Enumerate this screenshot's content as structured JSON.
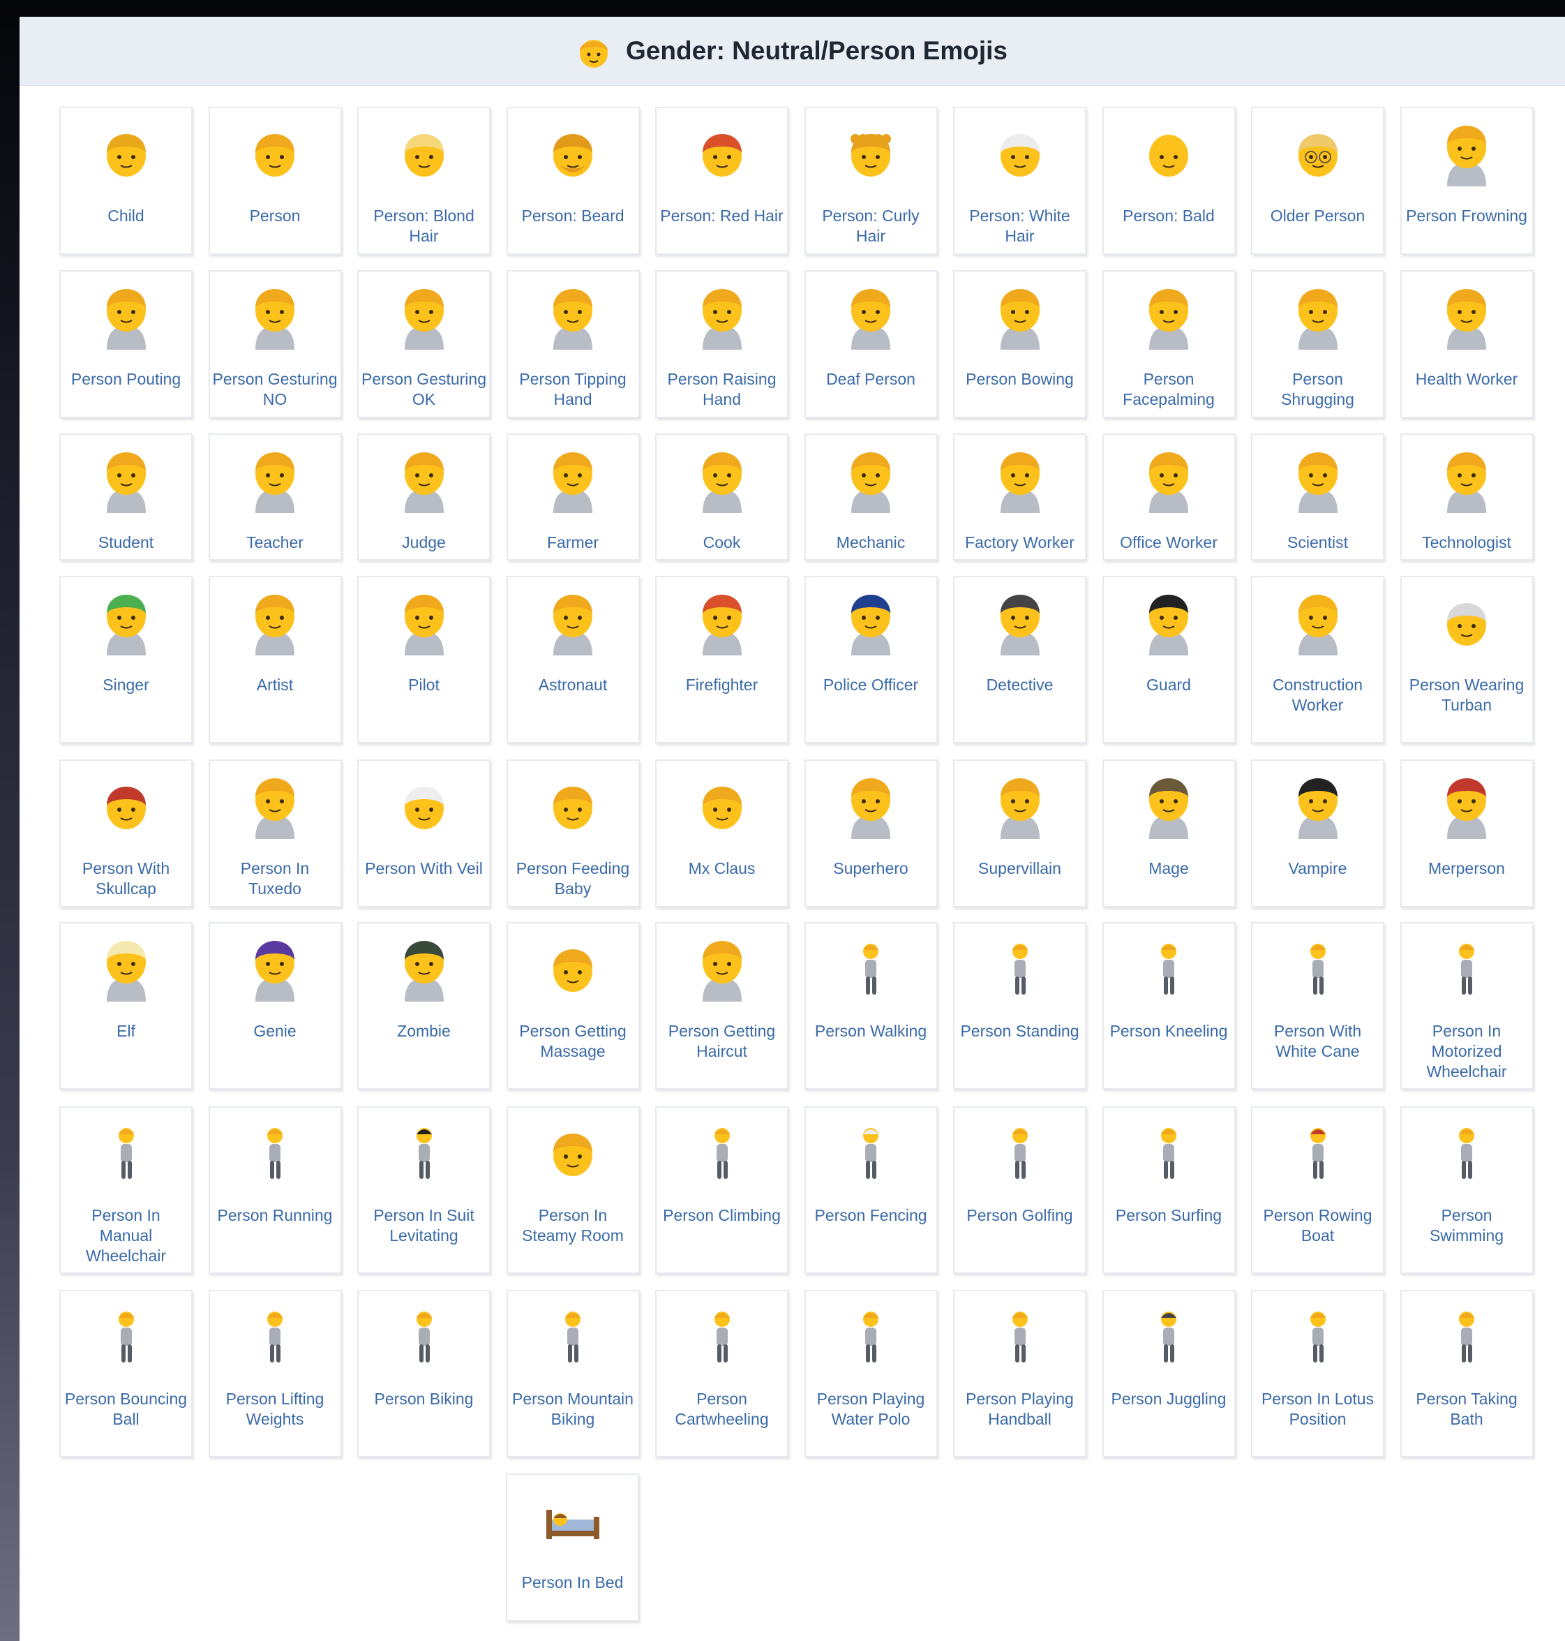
{
  "header": {
    "title": "Gender: Neutral/Person Emojis",
    "icon": "person-emoji-icon"
  },
  "colors": {
    "skin": "#fcc21b",
    "hair_blond": "#f5b31a",
    "link": "#3a6aa8",
    "header_bg": "#e9eef5"
  },
  "emojis": [
    {
      "label": "Child",
      "icon": "child-emoji-icon",
      "hair": "#e9a91a",
      "acc": ""
    },
    {
      "label": "Person",
      "icon": "person-emoji-icon",
      "hair": "#f0a91c",
      "acc": ""
    },
    {
      "label": "Person: Blond Hair",
      "icon": "person-blond-hair-emoji-icon",
      "hair": "#f6d77a",
      "acc": ""
    },
    {
      "label": "Person: Beard",
      "icon": "person-beard-emoji-icon",
      "hair": "#e29a1a",
      "acc": "beard"
    },
    {
      "label": "Person: Red Hair",
      "icon": "person-red-hair-emoji-icon",
      "hair": "#d9502a",
      "acc": ""
    },
    {
      "label": "Person: Curly Hair",
      "icon": "person-curly-hair-emoji-icon",
      "hair": "#e6a21a",
      "acc": "curly"
    },
    {
      "label": "Person: White Hair",
      "icon": "person-white-hair-emoji-icon",
      "hair": "#ececec",
      "acc": ""
    },
    {
      "label": "Person: Bald",
      "icon": "person-bald-emoji-icon",
      "hair": "",
      "acc": ""
    },
    {
      "label": "Older Person",
      "icon": "older-person-emoji-icon",
      "hair": "#f0c96a",
      "acc": "glasses"
    },
    {
      "label": "Person Frowning",
      "icon": "person-frowning-emoji-icon",
      "hair": "#f0a91c",
      "acc": "body"
    },
    {
      "label": "Person Pouting",
      "icon": "person-pouting-emoji-icon",
      "hair": "#f0a91c",
      "acc": "body"
    },
    {
      "label": "Person Gesturing NO",
      "icon": "person-gesturing-no-emoji-icon",
      "hair": "#f0a91c",
      "acc": "body"
    },
    {
      "label": "Person Gesturing OK",
      "icon": "person-gesturing-ok-emoji-icon",
      "hair": "#f0a91c",
      "acc": "body"
    },
    {
      "label": "Person Tipping Hand",
      "icon": "person-tipping-hand-emoji-icon",
      "hair": "#f0a91c",
      "acc": "body"
    },
    {
      "label": "Person Raising Hand",
      "icon": "person-raising-hand-emoji-icon",
      "hair": "#f0a91c",
      "acc": "body"
    },
    {
      "label": "Deaf Person",
      "icon": "deaf-person-emoji-icon",
      "hair": "#f0a91c",
      "acc": "body"
    },
    {
      "label": "Person Bowing",
      "icon": "person-bowing-emoji-icon",
      "hair": "#f0a91c",
      "acc": "body"
    },
    {
      "label": "Person Facepalming",
      "icon": "person-facepalming-emoji-icon",
      "hair": "#f0a91c",
      "acc": "body"
    },
    {
      "label": "Person Shrugging",
      "icon": "person-shrugging-emoji-icon",
      "hair": "#f0a91c",
      "acc": "body"
    },
    {
      "label": "Health Worker",
      "icon": "health-worker-emoji-icon",
      "hair": "#f0a91c",
      "acc": "body"
    },
    {
      "label": "Student",
      "icon": "student-emoji-icon",
      "hair": "#f0a91c",
      "acc": "body"
    },
    {
      "label": "Teacher",
      "icon": "teacher-emoji-icon",
      "hair": "#f0a91c",
      "acc": "body"
    },
    {
      "label": "Judge",
      "icon": "judge-emoji-icon",
      "hair": "#f0a91c",
      "acc": "body"
    },
    {
      "label": "Farmer",
      "icon": "farmer-emoji-icon",
      "hair": "#f0a91c",
      "acc": "body"
    },
    {
      "label": "Cook",
      "icon": "cook-emoji-icon",
      "hair": "#f0a91c",
      "acc": "body"
    },
    {
      "label": "Mechanic",
      "icon": "mechanic-emoji-icon",
      "hair": "#f0a91c",
      "acc": "body"
    },
    {
      "label": "Factory Worker",
      "icon": "factory-worker-emoji-icon",
      "hair": "#f0a91c",
      "acc": "body"
    },
    {
      "label": "Office Worker",
      "icon": "office-worker-emoji-icon",
      "hair": "#f0a91c",
      "acc": "body"
    },
    {
      "label": "Scientist",
      "icon": "scientist-emoji-icon",
      "hair": "#f0a91c",
      "acc": "body"
    },
    {
      "label": "Technologist",
      "icon": "technologist-emoji-icon",
      "hair": "#f0a91c",
      "acc": "body"
    },
    {
      "label": "Singer",
      "icon": "singer-emoji-icon",
      "hair": "#4caf50",
      "acc": "body"
    },
    {
      "label": "Artist",
      "icon": "artist-emoji-icon",
      "hair": "#f0a91c",
      "acc": "body"
    },
    {
      "label": "Pilot",
      "icon": "pilot-emoji-icon",
      "hair": "#f0a91c",
      "acc": "body"
    },
    {
      "label": "Astronaut",
      "icon": "astronaut-emoji-icon",
      "hair": "#f0a91c",
      "acc": "body"
    },
    {
      "label": "Firefighter",
      "icon": "firefighter-emoji-icon",
      "hair": "#d9502a",
      "acc": "body"
    },
    {
      "label": "Police Officer",
      "icon": "police-officer-emoji-icon",
      "hair": "#1f3f8f",
      "acc": "body"
    },
    {
      "label": "Detective",
      "icon": "detective-emoji-icon",
      "hair": "#444444",
      "acc": "body"
    },
    {
      "label": "Guard",
      "icon": "guard-emoji-icon",
      "hair": "#222222",
      "acc": "body"
    },
    {
      "label": "Construction Worker",
      "icon": "construction-worker-emoji-icon",
      "hair": "#f5b31a",
      "acc": "body"
    },
    {
      "label": "Person Wearing Turban",
      "icon": "person-wearing-turban-emoji-icon",
      "hair": "#d8d8d8",
      "acc": ""
    },
    {
      "label": "Person With Skullcap",
      "icon": "person-with-skullcap-emoji-icon",
      "hair": "#c0392b",
      "acc": ""
    },
    {
      "label": "Person In Tuxedo",
      "icon": "person-in-tuxedo-emoji-icon",
      "hair": "#f0a91c",
      "acc": "body"
    },
    {
      "label": "Person With Veil",
      "icon": "person-with-veil-emoji-icon",
      "hair": "#eeeeee",
      "acc": ""
    },
    {
      "label": "Person Feeding Baby",
      "icon": "person-feeding-baby-emoji-icon",
      "hair": "#f0a91c",
      "acc": ""
    },
    {
      "label": "Mx Claus",
      "icon": "mx-claus-emoji-icon",
      "hair": "#f0a91c",
      "acc": ""
    },
    {
      "label": "Superhero",
      "icon": "superhero-emoji-icon",
      "hair": "#f0a91c",
      "acc": "body"
    },
    {
      "label": "Supervillain",
      "icon": "supervillain-emoji-icon",
      "hair": "#f0a91c",
      "acc": "body"
    },
    {
      "label": "Mage",
      "icon": "mage-emoji-icon",
      "hair": "#6b5a3a",
      "acc": "body"
    },
    {
      "label": "Vampire",
      "icon": "vampire-emoji-icon",
      "hair": "#222222",
      "acc": "body"
    },
    {
      "label": "Merperson",
      "icon": "merperson-emoji-icon",
      "hair": "#c0392b",
      "acc": "body"
    },
    {
      "label": "Elf",
      "icon": "elf-emoji-icon",
      "hair": "#f6e9b0",
      "acc": "body"
    },
    {
      "label": "Genie",
      "icon": "genie-emoji-icon",
      "hair": "#5b3aa0",
      "acc": "body"
    },
    {
      "label": "Zombie",
      "icon": "zombie-emoji-icon",
      "hair": "#3a4a3a",
      "acc": "body"
    },
    {
      "label": "Person Getting Massage",
      "icon": "person-getting-massage-emoji-icon",
      "hair": "#f0a91c",
      "acc": ""
    },
    {
      "label": "Person Getting Haircut",
      "icon": "person-getting-haircut-emoji-icon",
      "hair": "#f0a91c",
      "acc": "body"
    },
    {
      "label": "Person Walking",
      "icon": "person-walking-emoji-icon",
      "hair": "#f0a91c",
      "acc": "small"
    },
    {
      "label": "Person Standing",
      "icon": "person-standing-emoji-icon",
      "hair": "#f0a91c",
      "acc": "small"
    },
    {
      "label": "Person Kneeling",
      "icon": "person-kneeling-emoji-icon",
      "hair": "#f0a91c",
      "acc": "small"
    },
    {
      "label": "Person With White Cane",
      "icon": "person-with-white-cane-emoji-icon",
      "hair": "#f0a91c",
      "acc": "small"
    },
    {
      "label": "Person In Motorized Wheelchair",
      "icon": "person-in-motorized-wheelchair-emoji-icon",
      "hair": "#f0a91c",
      "acc": "small"
    },
    {
      "label": "Person In Manual Wheelchair",
      "icon": "person-in-manual-wheelchair-emoji-icon",
      "hair": "#f0a91c",
      "acc": "small"
    },
    {
      "label": "Person Running",
      "icon": "person-running-emoji-icon",
      "hair": "#f0a91c",
      "acc": "small"
    },
    {
      "label": "Person In Suit Levitating",
      "icon": "person-in-suit-levitating-emoji-icon",
      "hair": "#222222",
      "acc": "small"
    },
    {
      "label": "Person In Steamy Room",
      "icon": "person-in-steamy-room-emoji-icon",
      "hair": "#f0a91c",
      "acc": ""
    },
    {
      "label": "Person Climbing",
      "icon": "person-climbing-emoji-icon",
      "hair": "#f0a91c",
      "acc": "small"
    },
    {
      "label": "Person Fencing",
      "icon": "person-fencing-emoji-icon",
      "hair": "#eeeeee",
      "acc": "small"
    },
    {
      "label": "Person Golfing",
      "icon": "person-golfing-emoji-icon",
      "hair": "#f0a91c",
      "acc": "small"
    },
    {
      "label": "Person Surfing",
      "icon": "person-surfing-emoji-icon",
      "hair": "#f0a91c",
      "acc": "small"
    },
    {
      "label": "Person Rowing Boat",
      "icon": "person-rowing-boat-emoji-icon",
      "hair": "#c0392b",
      "acc": "small"
    },
    {
      "label": "Person Swimming",
      "icon": "person-swimming-emoji-icon",
      "hair": "#f0a91c",
      "acc": "small"
    },
    {
      "label": "Person Bouncing Ball",
      "icon": "person-bouncing-ball-emoji-icon",
      "hair": "#f0a91c",
      "acc": "small"
    },
    {
      "label": "Person Lifting Weights",
      "icon": "person-lifting-weights-emoji-icon",
      "hair": "#f0a91c",
      "acc": "small"
    },
    {
      "label": "Person Biking",
      "icon": "person-biking-emoji-icon",
      "hair": "#f0a91c",
      "acc": "small"
    },
    {
      "label": "Person Mountain Biking",
      "icon": "person-mountain-biking-emoji-icon",
      "hair": "#f0a91c",
      "acc": "small"
    },
    {
      "label": "Person Cartwheeling",
      "icon": "person-cartwheeling-emoji-icon",
      "hair": "#f0a91c",
      "acc": "small"
    },
    {
      "label": "Person Playing Water Polo",
      "icon": "person-playing-water-polo-emoji-icon",
      "hair": "#f0a91c",
      "acc": "small"
    },
    {
      "label": "Person Playing Handball",
      "icon": "person-playing-handball-emoji-icon",
      "hair": "#f0a91c",
      "acc": "small"
    },
    {
      "label": "Person Juggling",
      "icon": "person-juggling-emoji-icon",
      "hair": "#444444",
      "acc": "small"
    },
    {
      "label": "Person In Lotus Position",
      "icon": "person-in-lotus-position-emoji-icon",
      "hair": "#f0a91c",
      "acc": "small"
    },
    {
      "label": "Person Taking Bath",
      "icon": "person-taking-bath-emoji-icon",
      "hair": "#f0a91c",
      "acc": "small"
    },
    {
      "label": "Person In Bed",
      "icon": "person-in-bed-emoji-icon",
      "hair": "#8d5a2b",
      "acc": "bed"
    }
  ]
}
